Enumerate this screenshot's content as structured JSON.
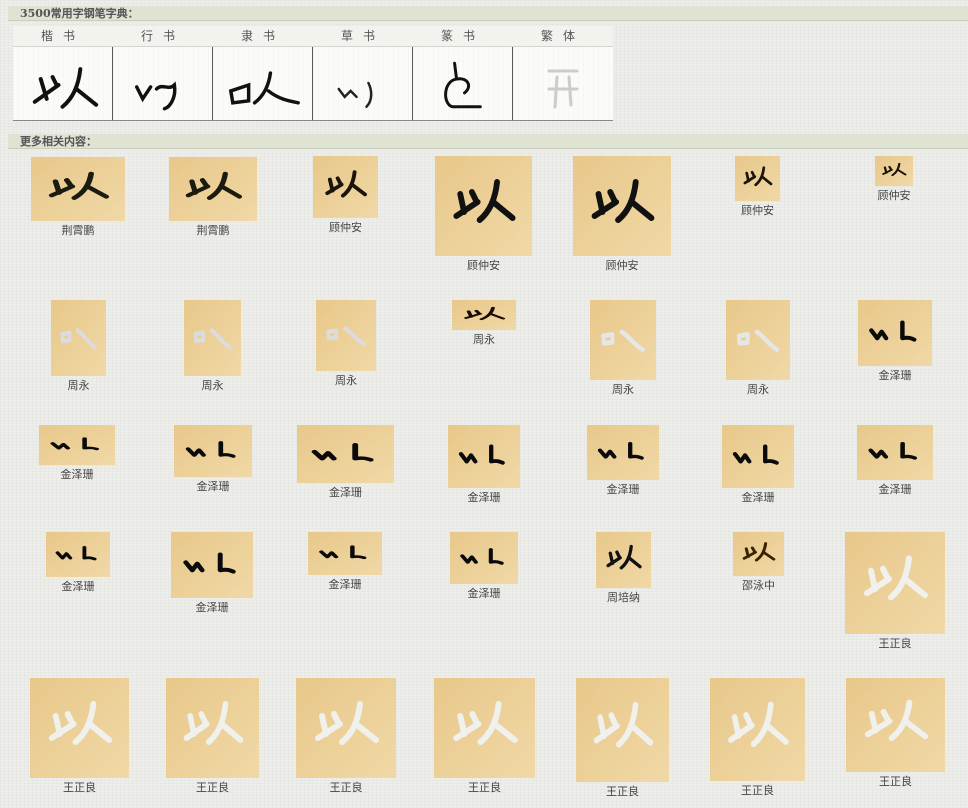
{
  "header1": "3500常用字钢笔字典：",
  "header2": "更多相关内容：",
  "dictionary": {
    "columns": [
      "楷书",
      "行书",
      "隶书",
      "草书",
      "篆书",
      "繁体"
    ]
  },
  "colors": {
    "header_bar": "#dfe3d3",
    "page_bg": "#ededea"
  },
  "items": [
    {
      "caption": "荆霄鹏",
      "style": "tan"
    },
    {
      "caption": "荆霄鹏",
      "style": "tan"
    },
    {
      "caption": "顾仲安",
      "style": "orange"
    },
    {
      "caption": "顾仲安",
      "style": "paper"
    },
    {
      "caption": "顾仲安",
      "style": "paper"
    },
    {
      "caption": "顾仲安",
      "style": "orange"
    },
    {
      "caption": "顾仲安",
      "style": "orange"
    },
    {
      "caption": "周永",
      "style": "black"
    },
    {
      "caption": "周永",
      "style": "black"
    },
    {
      "caption": "周永",
      "style": "black"
    },
    {
      "caption": "周永",
      "style": "salmon"
    },
    {
      "caption": "周永",
      "style": "gray"
    },
    {
      "caption": "周永",
      "style": "gray"
    },
    {
      "caption": "金泽珊",
      "style": "white"
    },
    {
      "caption": "金泽珊",
      "style": "white"
    },
    {
      "caption": "金泽珊",
      "style": "white"
    },
    {
      "caption": "金泽珊",
      "style": "white"
    },
    {
      "caption": "金泽珊",
      "style": "white"
    },
    {
      "caption": "金泽珊",
      "style": "white"
    },
    {
      "caption": "金泽珊",
      "style": "white"
    },
    {
      "caption": "金泽珊",
      "style": "white"
    },
    {
      "caption": "金泽珊",
      "style": "white"
    },
    {
      "caption": "金泽珊",
      "style": "white"
    },
    {
      "caption": "金泽珊",
      "style": "white"
    },
    {
      "caption": "金泽珊",
      "style": "white"
    },
    {
      "caption": "周培纳",
      "style": "paper"
    },
    {
      "caption": "邵泳中",
      "style": "gold"
    },
    {
      "caption": "王正良",
      "style": "rubbing"
    },
    {
      "caption": "王正良",
      "style": "rubbing"
    },
    {
      "caption": "王正良",
      "style": "rubbing"
    },
    {
      "caption": "王正良",
      "style": "rubbing"
    },
    {
      "caption": "王正良",
      "style": "rubbing"
    },
    {
      "caption": "王正良",
      "style": "rubbing"
    },
    {
      "caption": "王正良",
      "style": "rubbing"
    },
    {
      "caption": "王正良",
      "style": "rubbing"
    }
  ]
}
